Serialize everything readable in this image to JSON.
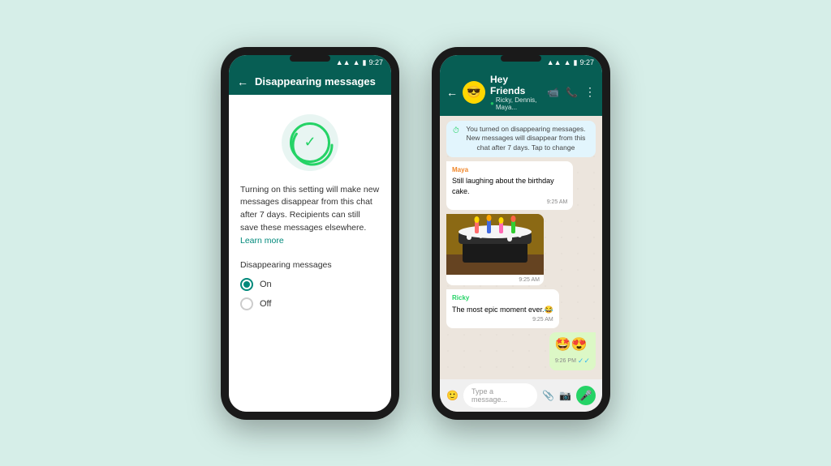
{
  "background_color": "#d6eee8",
  "phone1": {
    "status_bar": {
      "time": "9:27",
      "icons": [
        "signal",
        "wifi",
        "battery"
      ]
    },
    "header": {
      "back_label": "←",
      "title": "Disappearing messages"
    },
    "icon": {
      "type": "timer-check"
    },
    "description": "Turning on this setting will make new messages disappear from this chat after 7 days. Recipients can still save these messages elsewhere.",
    "learn_more_label": "Learn more",
    "section_label": "Disappearing messages",
    "options": [
      {
        "label": "On",
        "selected": true
      },
      {
        "label": "Off",
        "selected": false
      }
    ]
  },
  "phone2": {
    "status_bar": {
      "time": "9:27",
      "icons": [
        "signal",
        "wifi",
        "battery"
      ]
    },
    "header": {
      "back_label": "←",
      "chat_name": "Hey Friends",
      "chat_subtitle": "Ricky, Dennis, Maya...",
      "avatar_emoji": "😎",
      "icons": [
        "video",
        "phone",
        "more"
      ]
    },
    "system_message": "You turned on disappearing messages. New messages will disappear from this chat after 7 days. Tap to change",
    "messages": [
      {
        "type": "received",
        "sender": "Maya",
        "sender_color": "orange",
        "text": "Still laughing about the birthday cake.",
        "time": "9:25 AM"
      },
      {
        "type": "image",
        "caption": "",
        "time": "9:25 AM"
      },
      {
        "type": "received",
        "sender": "Ricky",
        "sender_color": "green",
        "text": "The most epic moment ever.😂",
        "time": "9:25 AM"
      },
      {
        "type": "sent",
        "emoji": "🤩😍",
        "time": "9:26 PM",
        "read": true
      }
    ],
    "input": {
      "placeholder": "Type a message...",
      "icons": [
        "emoji",
        "attach",
        "camera"
      ]
    }
  }
}
